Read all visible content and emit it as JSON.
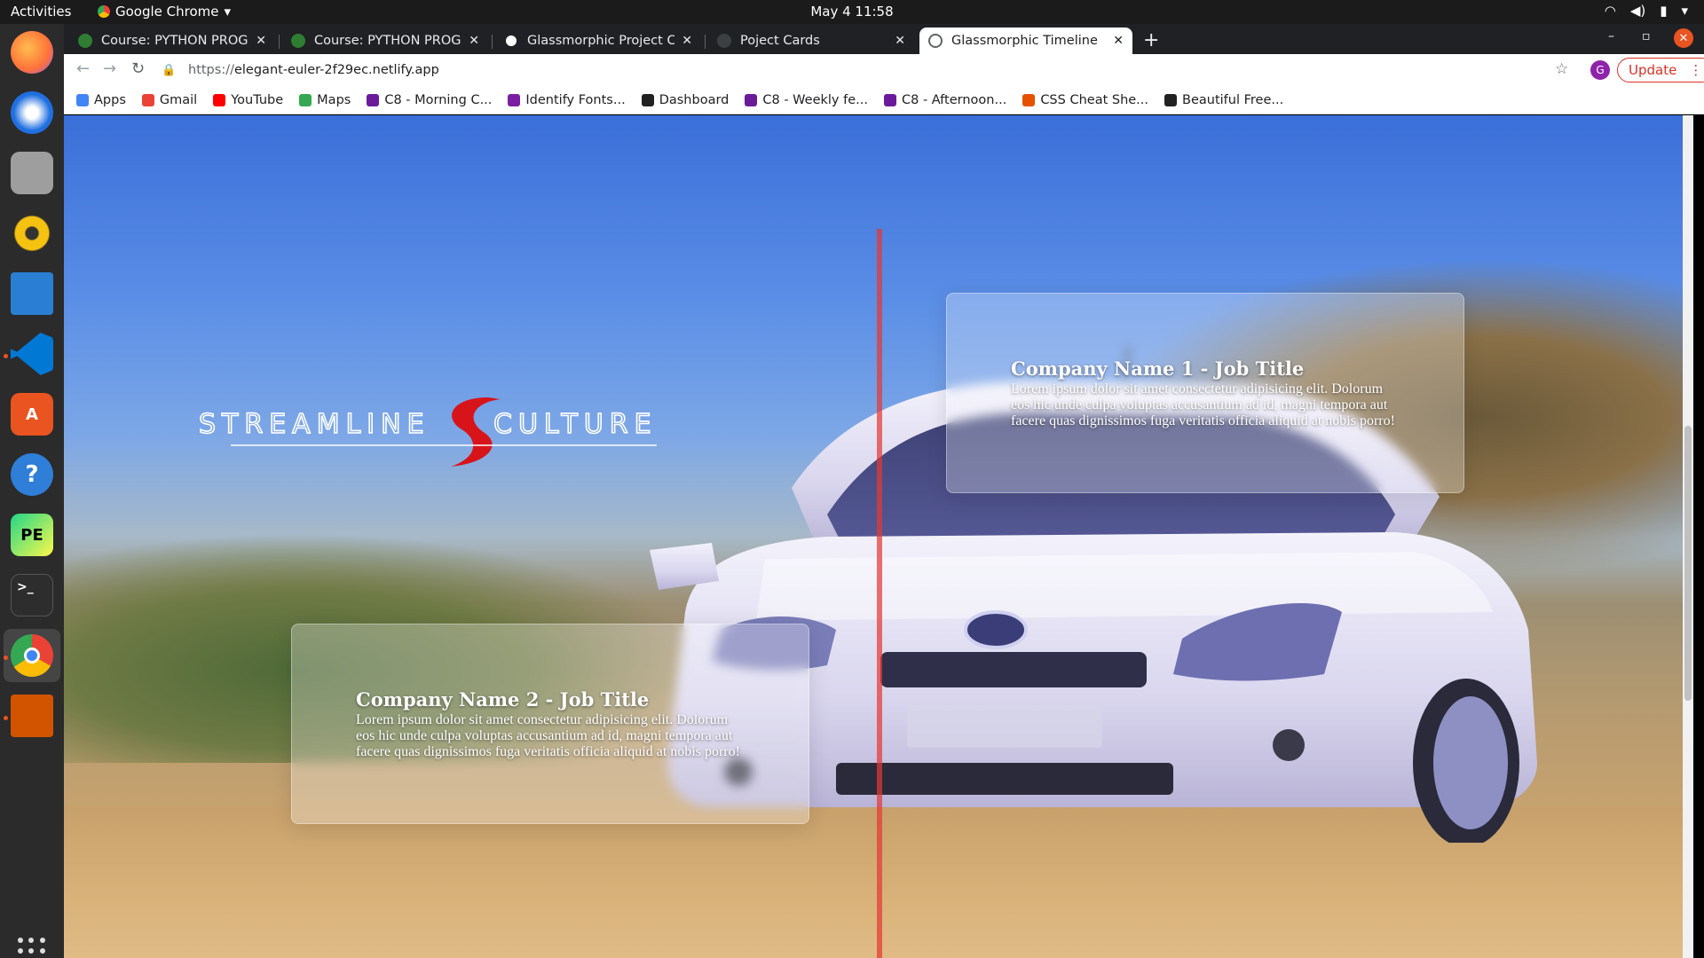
{
  "os_topbar": {
    "activities": "Activities",
    "app_name": "Google Chrome",
    "datetime": "May 4  11:58"
  },
  "dock": {
    "items": [
      "firefox",
      "thunderbird",
      "files",
      "rhythmbox",
      "libreoffice-writer",
      "vscode",
      "software-center",
      "help",
      "pycharm",
      "terminal",
      "chrome",
      "libreoffice-impress",
      "show-apps"
    ]
  },
  "browser": {
    "tabs": [
      {
        "title": "Course: PYTHON PROGRA",
        "active": false
      },
      {
        "title": "Course: PYTHON PROGRA",
        "active": false
      },
      {
        "title": "Glassmorphic Project Car",
        "active": false
      },
      {
        "title": "Poject Cards",
        "active": false
      },
      {
        "title": "Glassmorphic Timeline",
        "active": true
      }
    ],
    "url_scheme": "https://",
    "url_host": "elegant-euler-2f29ec.netlify.app",
    "profile_initial": "G",
    "update_label": "Update",
    "bookmarks": [
      {
        "label": "Apps",
        "color": "#4285f4"
      },
      {
        "label": "Gmail",
        "color": "#ea4335"
      },
      {
        "label": "YouTube",
        "color": "#ff0000"
      },
      {
        "label": "Maps",
        "color": "#34a853"
      },
      {
        "label": "C8 - Morning C...",
        "color": "#6a1b9a"
      },
      {
        "label": "Identify Fonts...",
        "color": "#7b1fa2"
      },
      {
        "label": "Dashboard",
        "color": "#212121"
      },
      {
        "label": "C8 - Weekly fe...",
        "color": "#6a1b9a"
      },
      {
        "label": "C8 - Afternoon...",
        "color": "#6a1b9a"
      },
      {
        "label": "CSS Cheat She...",
        "color": "#e65100"
      },
      {
        "label": "Beautiful Free...",
        "color": "#212121"
      }
    ]
  },
  "page": {
    "logo_left": "STREAMLINE",
    "logo_right": "CULTURE",
    "cards": [
      {
        "title": "Company Name 1 - Job Title",
        "body": "Lorem ipsum dolor sit amet consectetur adipisicing elit. Dolorum eos hic unde culpa voluptas accusantium ad id, magni tempora aut facere quas dignissimos fuga veritatis officia aliquid at nobis porro!"
      },
      {
        "title": "Company Name 2 - Job Title",
        "body": "Lorem ipsum dolor sit amet consectetur adipisicing elit. Dolorum eos hic unde culpa voluptas accusantium ad id, magni tempora aut facere quas dignissimos fuga veritatis officia aliquid at nobis porro!"
      }
    ],
    "accent_line_color": "#e53935"
  }
}
